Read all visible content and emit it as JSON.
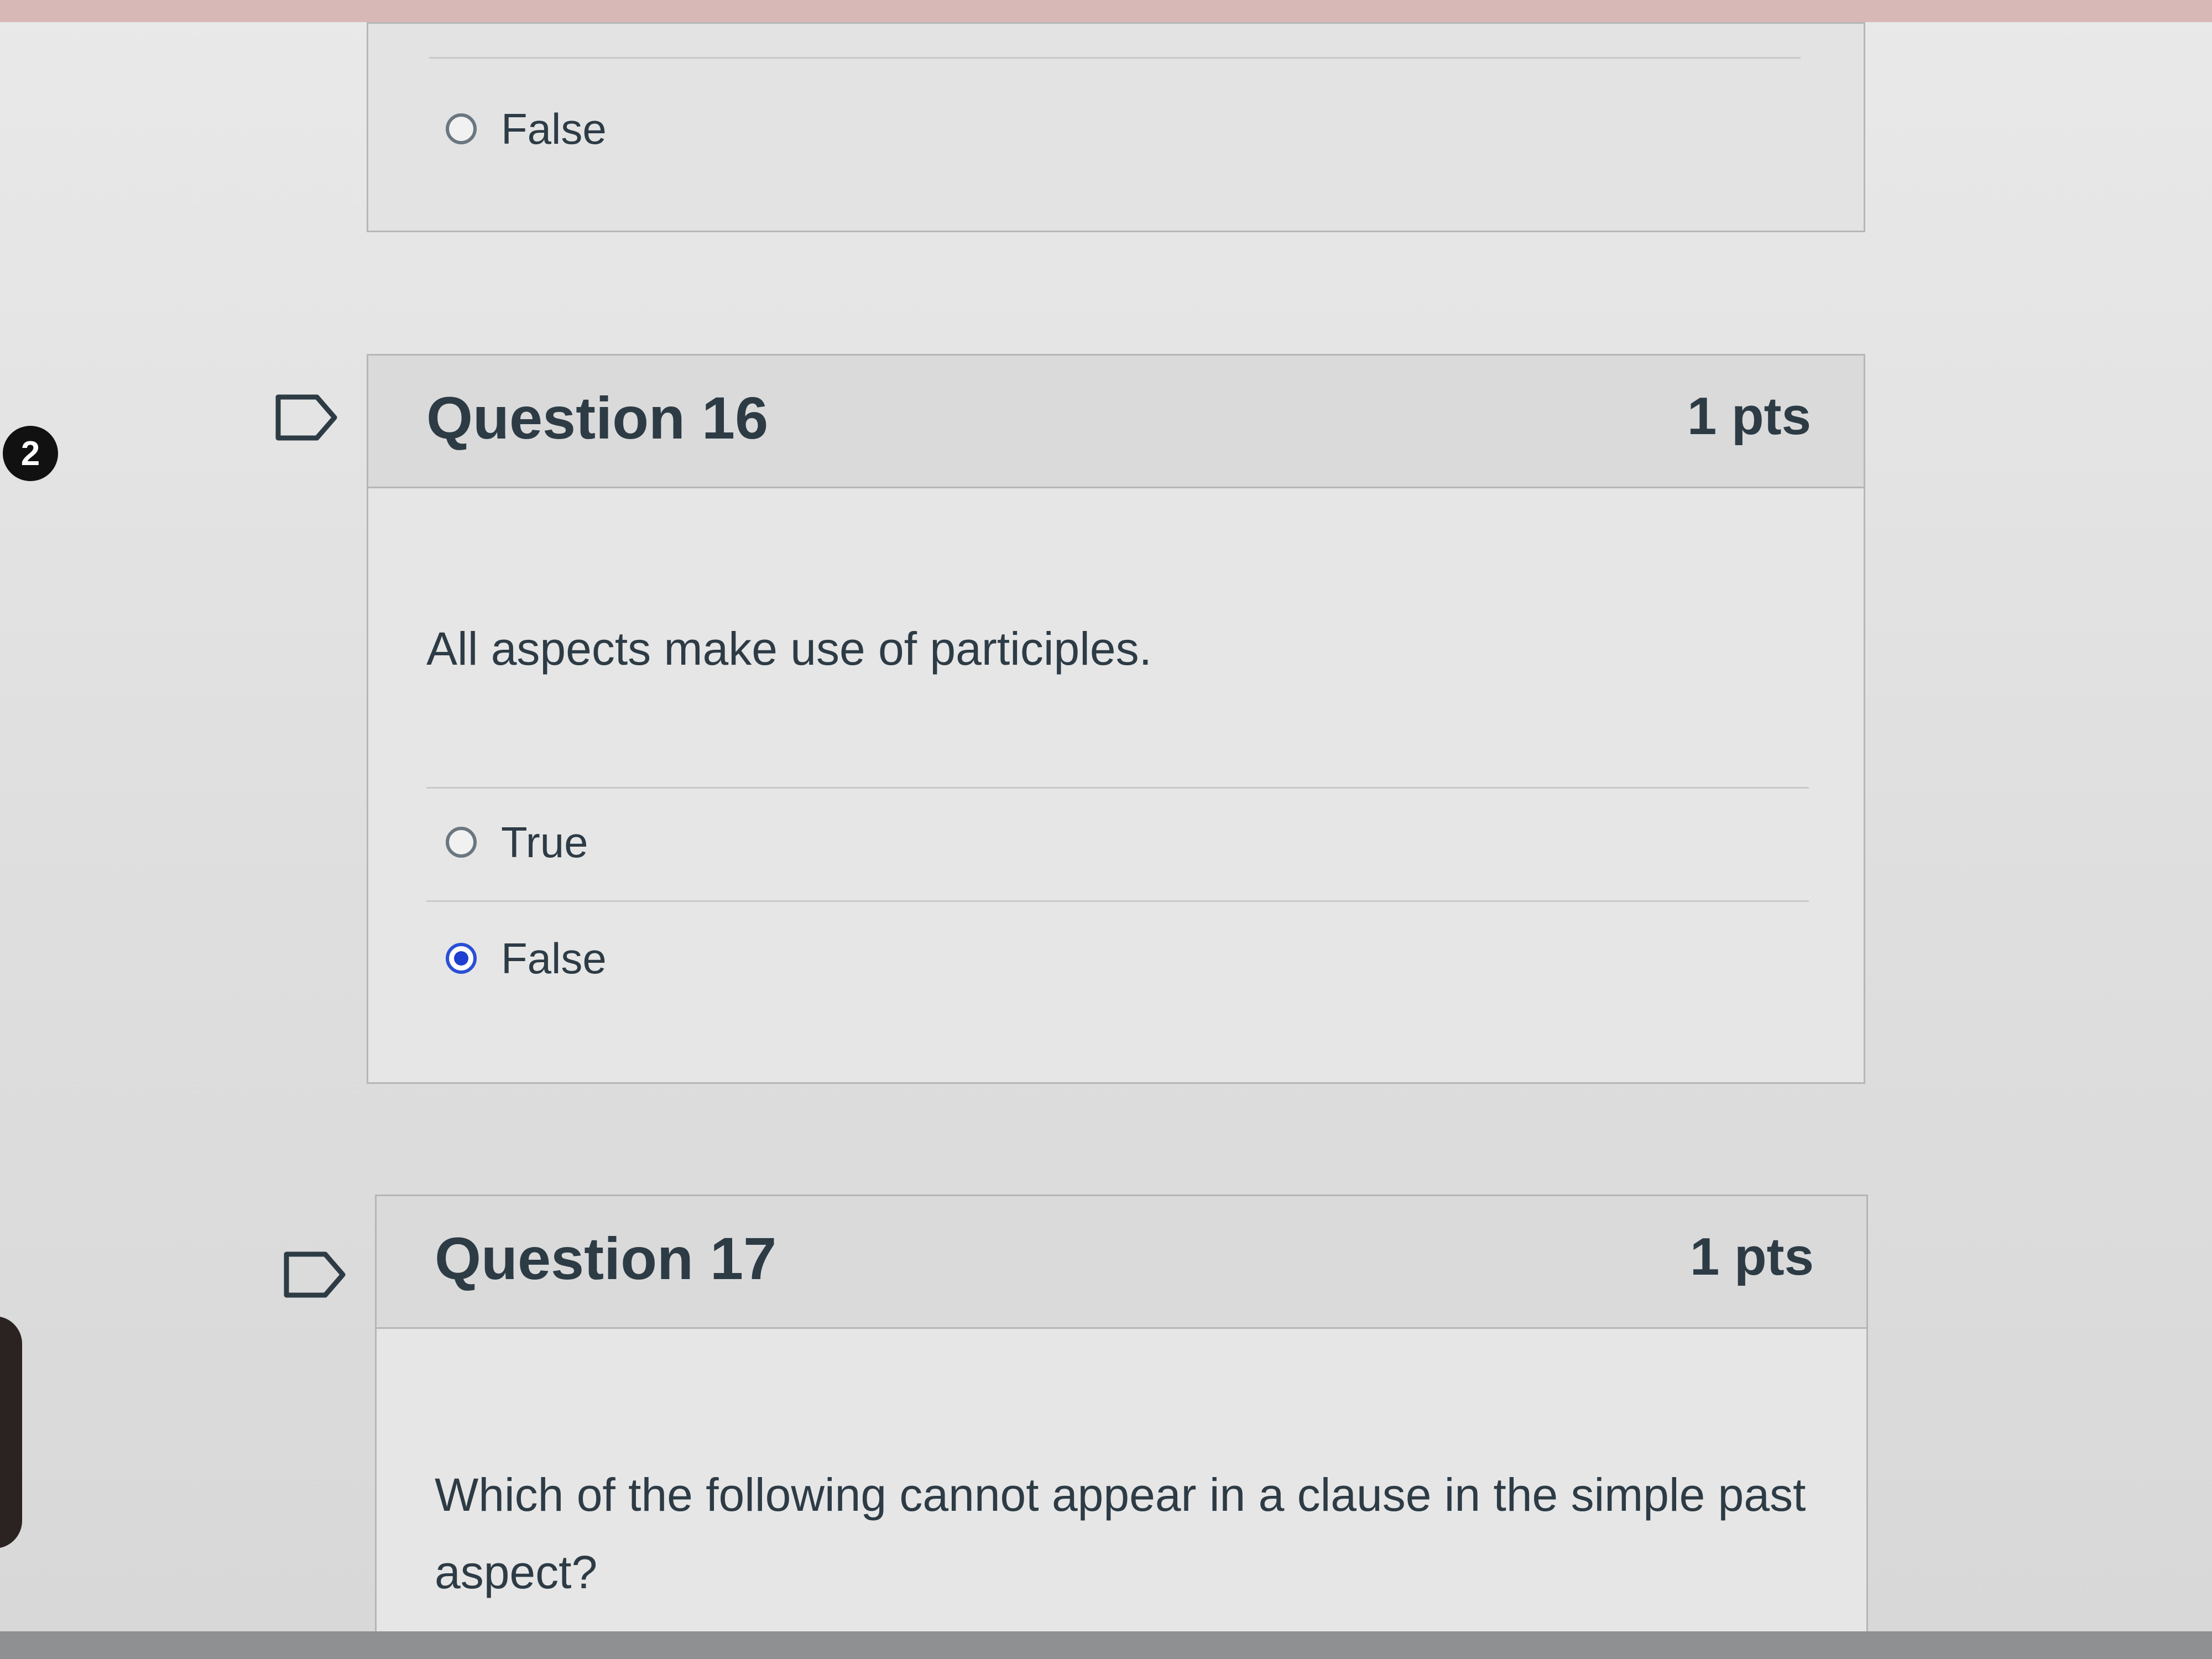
{
  "badge": {
    "count": "2"
  },
  "previous_question": {
    "answers": [
      {
        "label": "False",
        "selected": false
      }
    ]
  },
  "question16": {
    "title": "Question 16",
    "points": "1 pts",
    "text": "All aspects make use of participles.",
    "answers": [
      {
        "label": "True",
        "selected": false
      },
      {
        "label": "False",
        "selected": true
      }
    ]
  },
  "question17": {
    "title": "Question 17",
    "points": "1 pts",
    "text": "Which of the following cannot appear in a clause in the simple past aspect?"
  },
  "colors": {
    "selected_radio": "#1f3fd1",
    "text": "#2d3b45",
    "header_bg": "#dadada",
    "border": "#b6b6b6"
  },
  "icons": {
    "flag": "flag-question-icon",
    "radio": "radio-button-icon"
  }
}
